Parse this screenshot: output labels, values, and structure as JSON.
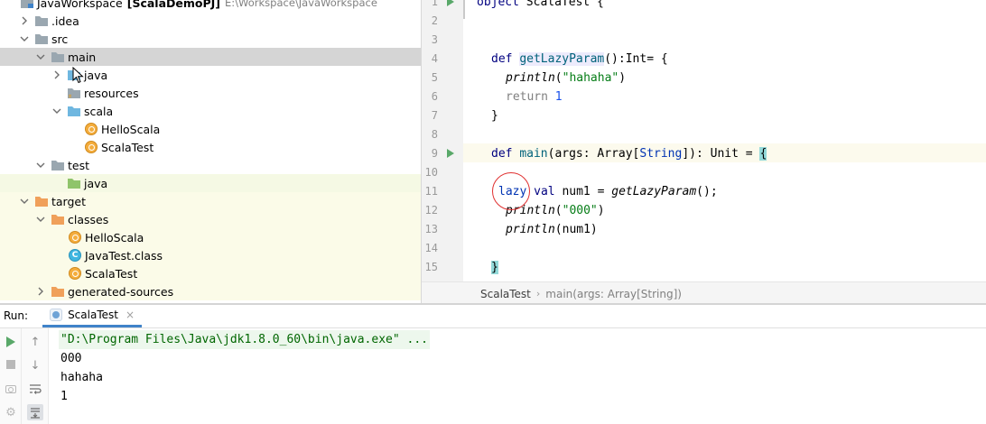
{
  "project_tree": {
    "root": {
      "label": "JavaWorkspace",
      "module": "[ScalaDemoPJ]",
      "path": "E:\\Workspace\\JavaWorkspace"
    },
    "items": [
      {
        "label": ".idea",
        "kind": "folder"
      },
      {
        "label": "src",
        "kind": "folder"
      },
      {
        "label": "main",
        "kind": "folder"
      },
      {
        "label": "java",
        "kind": "source-folder"
      },
      {
        "label": "resources",
        "kind": "resources-folder"
      },
      {
        "label": "scala",
        "kind": "source-folder"
      },
      {
        "label": "HelloScala",
        "kind": "scala-object"
      },
      {
        "label": "ScalaTest",
        "kind": "scala-object"
      },
      {
        "label": "test",
        "kind": "folder"
      },
      {
        "label": "java",
        "kind": "test-folder"
      },
      {
        "label": "target",
        "kind": "excluded-folder"
      },
      {
        "label": "classes",
        "kind": "excluded-folder"
      },
      {
        "label": "HelloScala",
        "kind": "scala-object"
      },
      {
        "label": "JavaTest.class",
        "kind": "class-file"
      },
      {
        "label": "ScalaTest",
        "kind": "scala-object"
      },
      {
        "label": "generated-sources",
        "kind": "excluded-folder"
      }
    ]
  },
  "editor": {
    "line_numbers": [
      "1",
      "2",
      "3",
      "4",
      "5",
      "6",
      "7",
      "8",
      "9",
      "10",
      "11",
      "12",
      "13",
      "14",
      "15"
    ],
    "code": {
      "l1_kw": "object",
      "l1_name": " ScalaTest {",
      "l4_def": "def ",
      "l4_fn": "getLazyParam",
      "l4_rest": "():Int= {",
      "l5_fn": "println",
      "l5_open": "(",
      "l5_str": "\"hahaha\"",
      "l5_close": ")",
      "l6_kw": "return ",
      "l6_num": "1",
      "l7": "}",
      "l9_def": "def ",
      "l9_fn": "main",
      "l9_a": "(args: Array[",
      "l9_t": "String",
      "l9_b": "]): Unit = ",
      "l9_brace": "{",
      "l11_lazy": "lazy",
      "l11_val": " val ",
      "l11_rest": "num1 = ",
      "l11_fn": "getLazyParam",
      "l11_end": "();",
      "l12_fn": "println",
      "l12_open": "(",
      "l12_str": "\"000\"",
      "l12_close": ")",
      "l13_fn": "println",
      "l13_rest": "(num1)",
      "l15": "}"
    },
    "breadcrumb": {
      "first": "ScalaTest",
      "second": "main(args: Array[String])"
    }
  },
  "run_panel": {
    "label": "Run:",
    "tab": "ScalaTest",
    "close_glyph": "×",
    "output": [
      "\"D:\\Program Files\\Java\\jdk1.8.0_60\\bin\\java.exe\" ...",
      "000",
      "hahaha",
      "1"
    ]
  },
  "icons": {
    "up_arrow": "↑",
    "down_arrow": "↓",
    "gear": "⚙"
  },
  "colors": {
    "run_green": "#59a869",
    "selection": "#d5d5d5",
    "annotation_circle": "#e03030",
    "tab_underline": "#4083c9"
  }
}
